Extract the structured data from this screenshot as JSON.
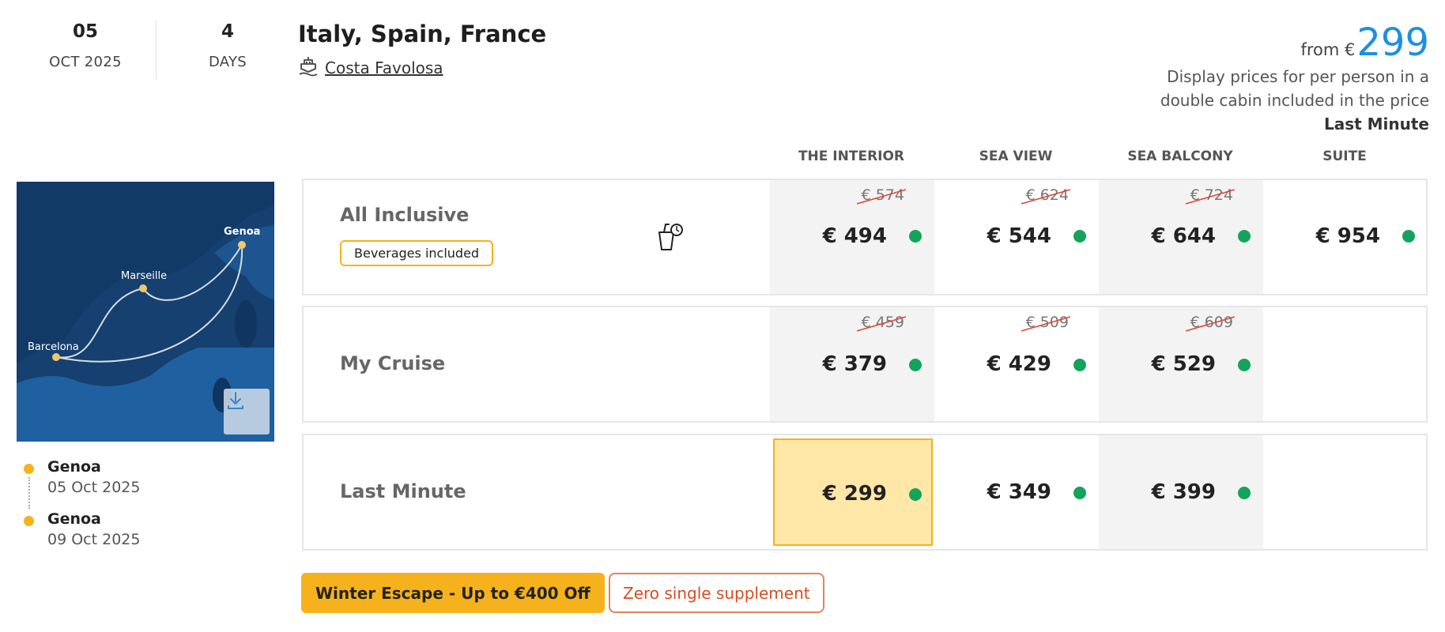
{
  "header": {
    "day": "05",
    "month_year": "OCT 2025",
    "duration": "4",
    "duration_unit": "DAYS",
    "title": "Italy, Spain, France",
    "ship_name": "Costa Favolosa",
    "ship_icon": "ship-icon"
  },
  "pricing": {
    "from_label": "from €",
    "from_price": "299",
    "note_line1": "Display prices for per person in a",
    "note_line2": "double cabin included in the price",
    "tag": "Last Minute",
    "accent_color": "#1d8fe3"
  },
  "columns": [
    "THE INTERIOR",
    "SEA VIEW",
    "SEA BALCONY",
    "SUITE"
  ],
  "map": {
    "cities": [
      "Genoa",
      "Marseille",
      "Barcelona"
    ],
    "download_icon": "download-icon"
  },
  "itinerary": [
    {
      "city": "Genoa",
      "date": "05 Oct 2025"
    },
    {
      "city": "Genoa",
      "date": "09 Oct 2025"
    }
  ],
  "rows": [
    {
      "name": "All Inclusive",
      "badge": "Beverages included",
      "icon": "beverage-icon",
      "old_prices": [
        "€ 574",
        "€ 624",
        "€ 724",
        ""
      ],
      "prices": [
        "€ 494",
        "€ 544",
        "€ 644",
        "€ 954"
      ]
    },
    {
      "name": "My Cruise",
      "old_prices": [
        "€ 459",
        "€ 509",
        "€ 609",
        ""
      ],
      "prices": [
        "€ 379",
        "€ 429",
        "€ 529",
        ""
      ]
    },
    {
      "name": "Last Minute",
      "old_prices": [
        "",
        "",
        "",
        ""
      ],
      "prices": [
        "€ 299",
        "€ 349",
        "€ 399",
        ""
      ]
    }
  ],
  "promos": {
    "promo1": "Winter Escape - Up to €400 Off",
    "promo2": "Zero single supplement"
  },
  "colors": {
    "brand_yellow": "#f5b21c",
    "available_green": "#14a35a",
    "promo_red": "#d64d20"
  }
}
